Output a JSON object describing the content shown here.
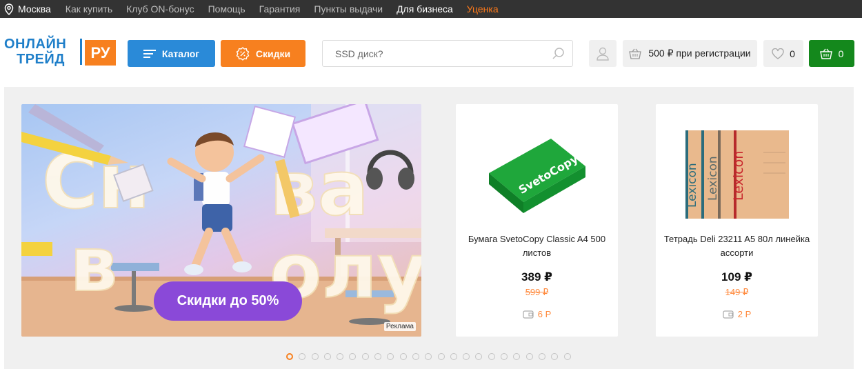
{
  "topbar": {
    "city": "Москва",
    "links": [
      "Как купить",
      "Клуб ON-бонус",
      "Помощь",
      "Гарантия",
      "Пункты выдачи"
    ],
    "business": "Для бизнеса",
    "discount": "Уценка"
  },
  "header": {
    "logo_line1": "ОНЛАЙН",
    "logo_line2": "ТРЕЙД",
    "logo_ru": "РУ",
    "catalog_label": "Каталог",
    "sale_label": "Скидки",
    "search_placeholder": "SSD диск?",
    "registration_bonus": "500 ₽ при регистрации",
    "favorites_count": "0",
    "cart_count": "0"
  },
  "banner": {
    "pill_text": "Скидки до 50%",
    "ad_label": "Реклама"
  },
  "products": [
    {
      "name": "Бумага SvetoCopy Classic A4 500 листов",
      "price": "389 ₽",
      "old_price": "599 ₽",
      "bonus": "6 Р"
    },
    {
      "name": "Тетрадь Deli 23211 A5 80л линейка ассорти",
      "price": "109 ₽",
      "old_price": "149 ₽",
      "bonus": "2 Р"
    }
  ],
  "pagination": {
    "total": 23,
    "active_index": 0
  },
  "colors": {
    "topbar_bg": "#333333",
    "catalog_blue": "#2a8ad8",
    "accent_orange": "#f7801f",
    "cart_green": "#14881c",
    "promo_purple": "#8a49d8"
  }
}
